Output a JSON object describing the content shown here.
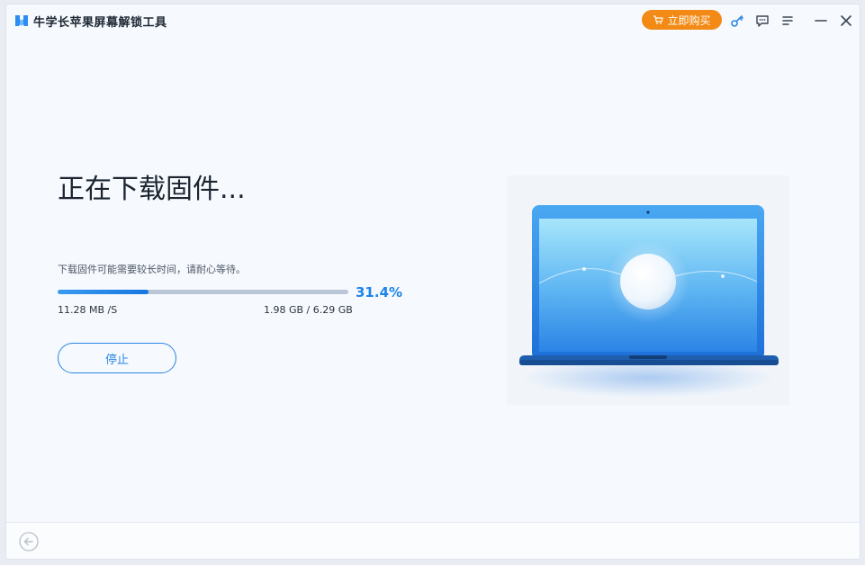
{
  "app": {
    "title": "牛学长苹果屏幕解锁工具",
    "buy_label": "立即购买"
  },
  "titlebar_icons": [
    "key-icon",
    "feedback-icon",
    "menu-icon",
    "minimize-icon",
    "close-icon"
  ],
  "main": {
    "heading": "正在下载固件...",
    "subtext": "下载固件可能需要较长时间，请耐心等待。",
    "progress_percent": 31.4,
    "percent_label": "31.4%",
    "speed": "11.28 MB /S",
    "sizes": "1.98 GB / 6.29 GB",
    "stop_label": "停止"
  },
  "colors": {
    "accent": "#2a86e6",
    "buy": "#f28a15",
    "heading": "#1b2430"
  }
}
